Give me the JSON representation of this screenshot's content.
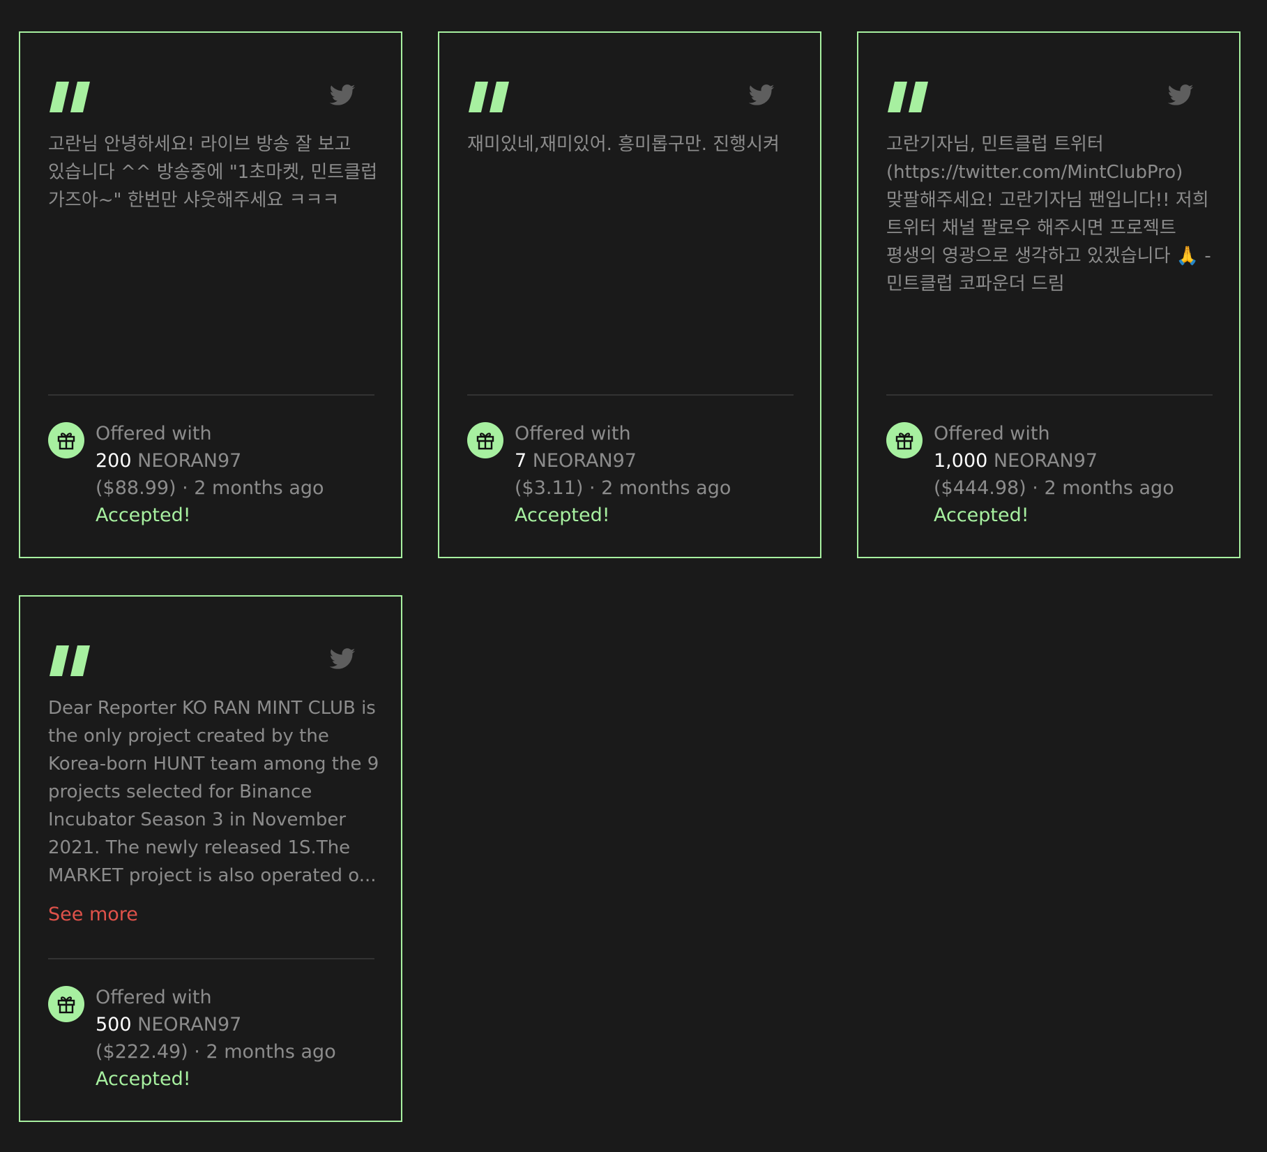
{
  "cards": [
    {
      "message": "고란님 안녕하세요! 라이브 방송 잘 보고 있습니다 ^^ 방송중에 \"1초마켓, 민트클럽 가즈아~\" 한번만 샤웃해주세요 ㅋㅋㅋ",
      "offered_label": "Offered with",
      "amount": "200",
      "token": "NEORAN97",
      "usd_time": "($88.99) · 2 months ago",
      "status": "Accepted!"
    },
    {
      "message": "재미있네,재미있어. 흥미롭구만. 진행시켜",
      "offered_label": "Offered with",
      "amount": "7",
      "token": "NEORAN97",
      "usd_time": "($3.11) · 2 months ago",
      "status": "Accepted!"
    },
    {
      "message": "고란기자님, 민트클럽 트위터 (https://twitter.com/MintClubPro) 맞팔해주세요! 고란기자님 팬입니다!! 저희 트위터 채널 팔로우 해주시면 프로젝트 평생의 영광으로 생각하고 있겠습니다 🙏 - 민트클럽 코파운더 드림",
      "offered_label": "Offered with",
      "amount": "1,000",
      "token": "NEORAN97",
      "usd_time": "($444.98) · 2 months ago",
      "status": "Accepted!"
    },
    {
      "message": "Dear Reporter KO RAN MINT CLUB is the only project created by the Korea-born HUNT team among the 9 projects selected for Binance Incubator Season 3 in November 2021. The newly released 1S.The MARKET project is also operated o...",
      "see_more": "See more",
      "offered_label": "Offered with",
      "amount": "500",
      "token": "NEORAN97",
      "usd_time": "($222.49) · 2 months ago",
      "status": "Accepted!"
    }
  ],
  "colors": {
    "background": "#1a1a1a",
    "accent_green": "#a7f0a0",
    "muted_text": "#8c8c8c",
    "link_red": "#e0524a"
  },
  "icons": {
    "quote": "quote-icon",
    "twitter": "twitter-icon",
    "gift": "gift-icon"
  }
}
